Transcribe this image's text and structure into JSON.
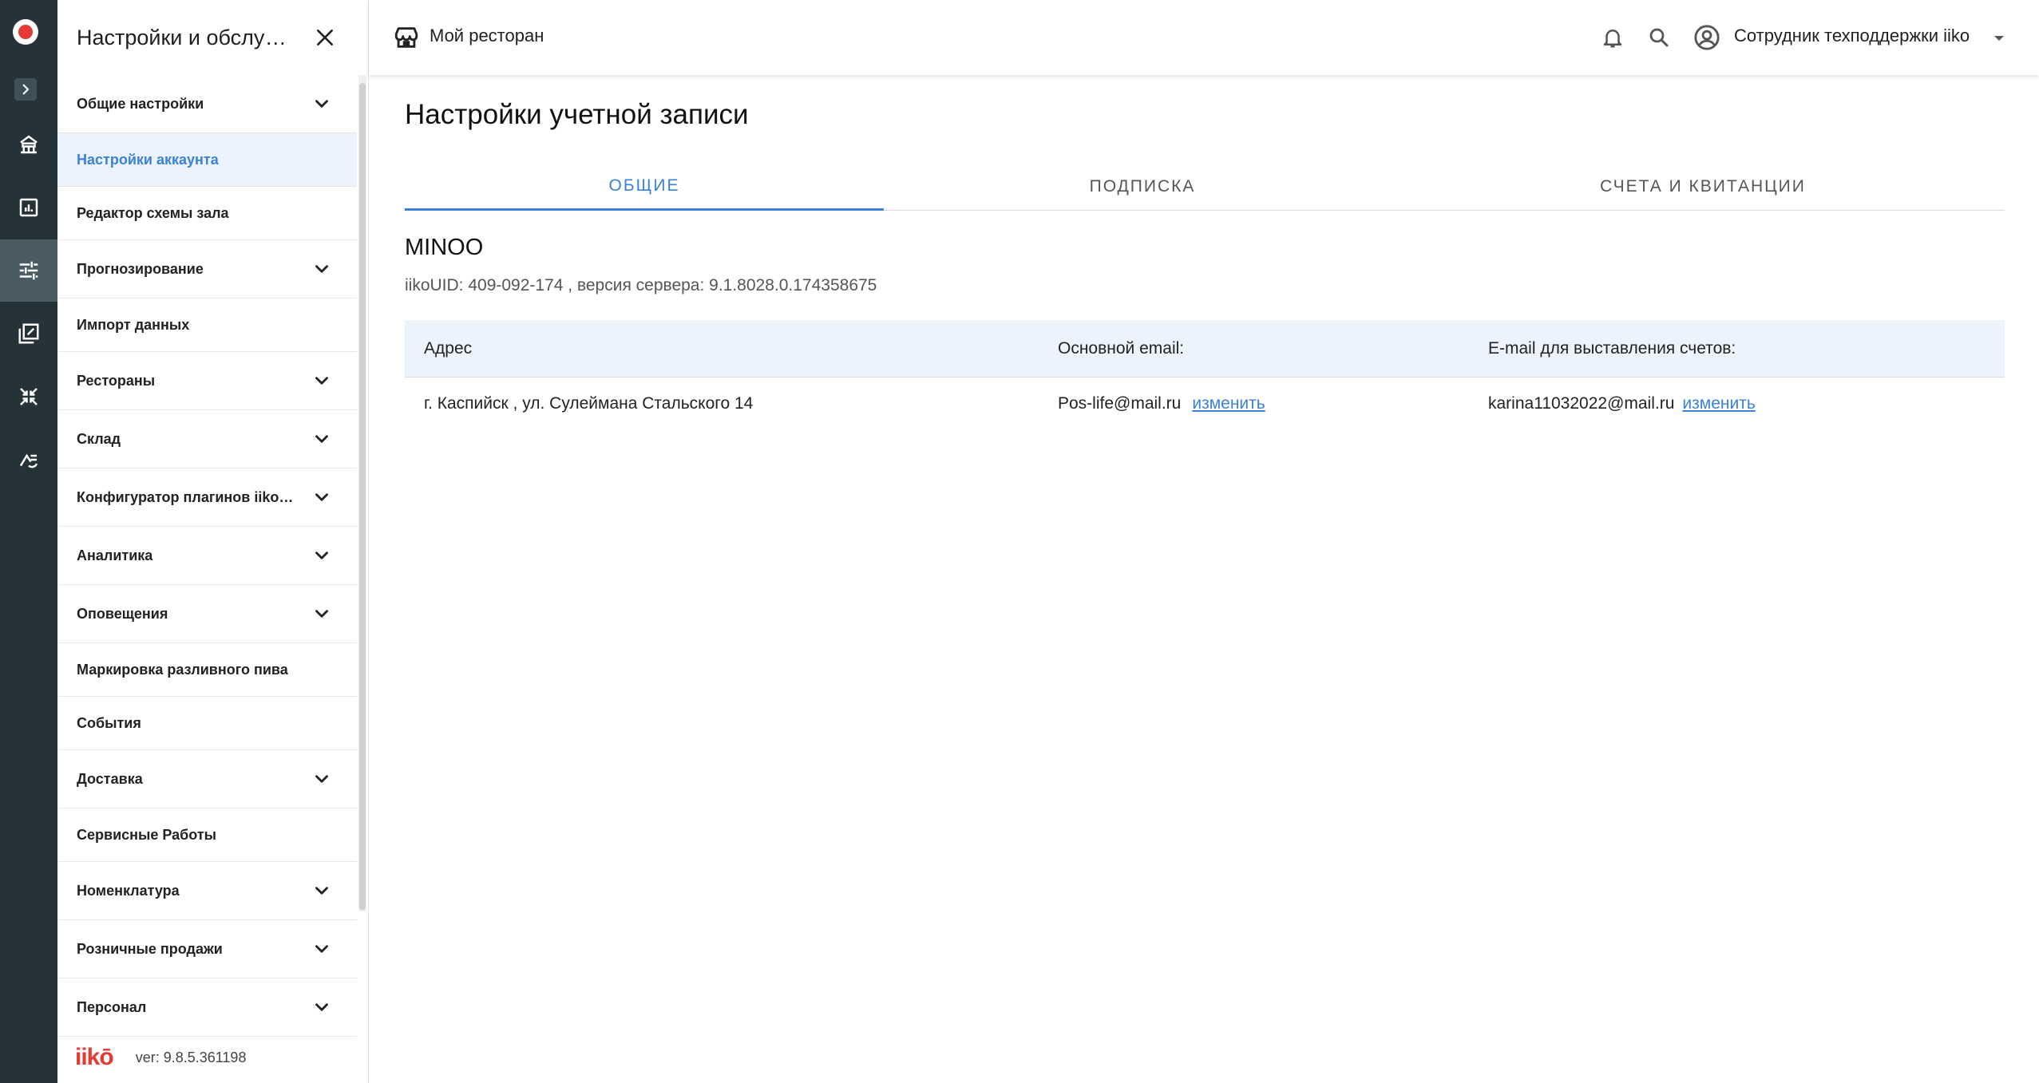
{
  "rail": {
    "items": [
      {
        "icon": "floor-plan-icon"
      },
      {
        "icon": "reports-icon"
      },
      {
        "icon": "settings-sliders-icon",
        "active": true
      },
      {
        "icon": "documents-icon"
      },
      {
        "icon": "integrations-icon"
      },
      {
        "icon": "exchange-icon"
      }
    ]
  },
  "panel": {
    "title": "Настройки и обслуживание",
    "menu": [
      {
        "label": "Общие настройки",
        "expandable": true
      },
      {
        "label": "Настройки аккаунта",
        "expandable": false,
        "active": true
      },
      {
        "label": "Редактор схемы зала",
        "expandable": false
      },
      {
        "label": "Прогнозирование",
        "expandable": true
      },
      {
        "label": "Импорт данных",
        "expandable": false
      },
      {
        "label": "Рестораны",
        "expandable": true
      },
      {
        "label": "Склад",
        "expandable": true
      },
      {
        "label": "Конфигуратор плагинов iikoFront",
        "expandable": true
      },
      {
        "label": "Аналитика",
        "expandable": true
      },
      {
        "label": "Оповещения",
        "expandable": true
      },
      {
        "label": "Маркировка разливного пива",
        "expandable": false
      },
      {
        "label": "События",
        "expandable": false
      },
      {
        "label": "Доставка",
        "expandable": true
      },
      {
        "label": "Сервисные Работы",
        "expandable": false
      },
      {
        "label": "Номенклатура",
        "expandable": true
      },
      {
        "label": "Розничные продажи",
        "expandable": true
      },
      {
        "label": "Персонал",
        "expandable": true
      }
    ],
    "footer": {
      "logo": "iikō",
      "version": "ver: 9.8.5.361198"
    }
  },
  "topbar": {
    "store_name": "Мой ресторан",
    "user_name": "Сотрудник техподдержки iiko"
  },
  "main": {
    "title": "Настройки учетной записи",
    "tabs": [
      {
        "label": "ОБЩИЕ",
        "active": true
      },
      {
        "label": "ПОДПИСКА",
        "active": false
      },
      {
        "label": "СЧЕТА И КВИТАНЦИИ",
        "active": false
      }
    ],
    "org_name": "MINOO",
    "org_meta": "iikoUID: 409-092-174 , версия сервера: 9.1.8028.0.174358675",
    "table": {
      "headers": [
        "Адрес",
        "Основной email:",
        "E-mail для выставления счетов:"
      ],
      "row": {
        "address": "г. Каспийск , ул. Сулеймана Стальского 14",
        "main_email": "Pos-life@mail.ru",
        "billing_email": "karina11032022@mail.ru",
        "change_label": "изменить"
      }
    }
  },
  "colors": {
    "rail_bg": "#253238",
    "accent": "#3b82d6",
    "active_bg": "#edf3fc",
    "brand_red": "#e53935"
  }
}
